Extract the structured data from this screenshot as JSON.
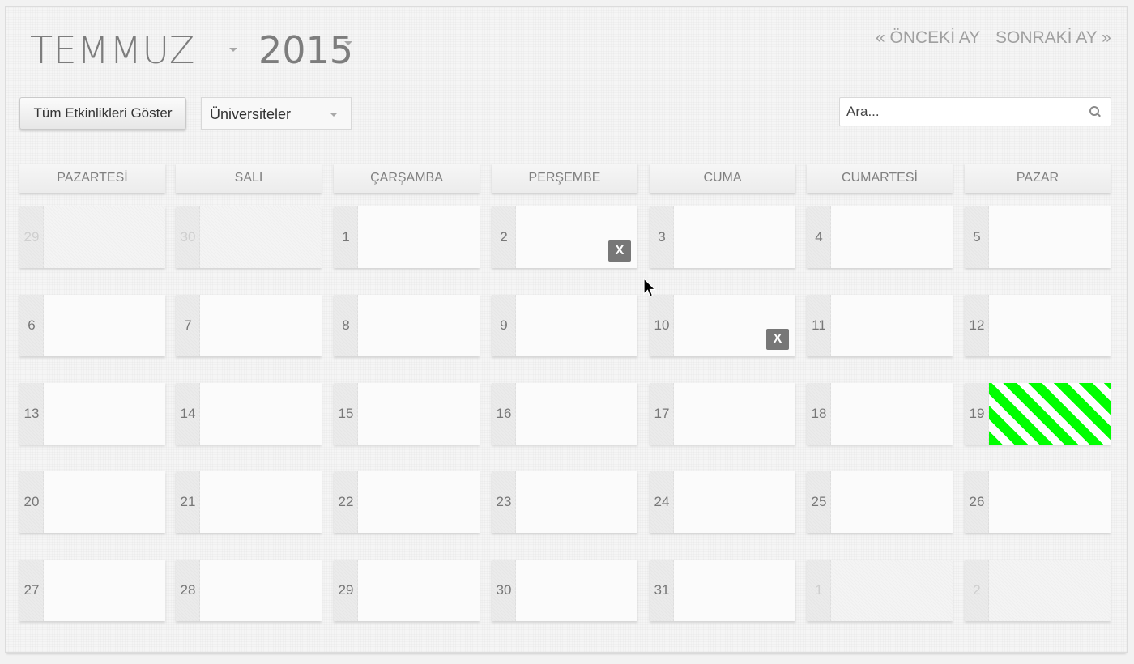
{
  "header": {
    "month": "TEMMUZ",
    "year": "2015",
    "prev_link": "« ÖNCEKİ AY",
    "next_link": "SONRAKİ AY »"
  },
  "toolbar": {
    "show_all_label": "Tüm Etkinlikleri Göster",
    "category_selected": "Üniversiteler",
    "search_placeholder": "Ara..."
  },
  "weekdays": [
    "PAZARTESİ",
    "SALI",
    "ÇARŞAMBA",
    "PERŞEMBE",
    "CUMA",
    "CUMARTESİ",
    "PAZAR"
  ],
  "calendar": {
    "weeks": [
      [
        {
          "day": "29",
          "muted": true
        },
        {
          "day": "30",
          "muted": true
        },
        {
          "day": "1"
        },
        {
          "day": "2",
          "remove": true
        },
        {
          "day": "3"
        },
        {
          "day": "4"
        },
        {
          "day": "5"
        }
      ],
      [
        {
          "day": "6"
        },
        {
          "day": "7"
        },
        {
          "day": "8"
        },
        {
          "day": "9"
        },
        {
          "day": "10",
          "remove": true
        },
        {
          "day": "11"
        },
        {
          "day": "12"
        }
      ],
      [
        {
          "day": "13"
        },
        {
          "day": "14"
        },
        {
          "day": "15"
        },
        {
          "day": "16"
        },
        {
          "day": "17"
        },
        {
          "day": "18"
        },
        {
          "day": "19",
          "highlight": true
        }
      ],
      [
        {
          "day": "20"
        },
        {
          "day": "21"
        },
        {
          "day": "22"
        },
        {
          "day": "23"
        },
        {
          "day": "24"
        },
        {
          "day": "25"
        },
        {
          "day": "26"
        }
      ],
      [
        {
          "day": "27"
        },
        {
          "day": "28"
        },
        {
          "day": "29"
        },
        {
          "day": "30"
        },
        {
          "day": "31"
        },
        {
          "day": "1",
          "muted": true
        },
        {
          "day": "2",
          "muted": true
        }
      ]
    ],
    "remove_label": "X",
    "highlight_colors": [
      "#00ff00",
      "#ffffff"
    ]
  }
}
